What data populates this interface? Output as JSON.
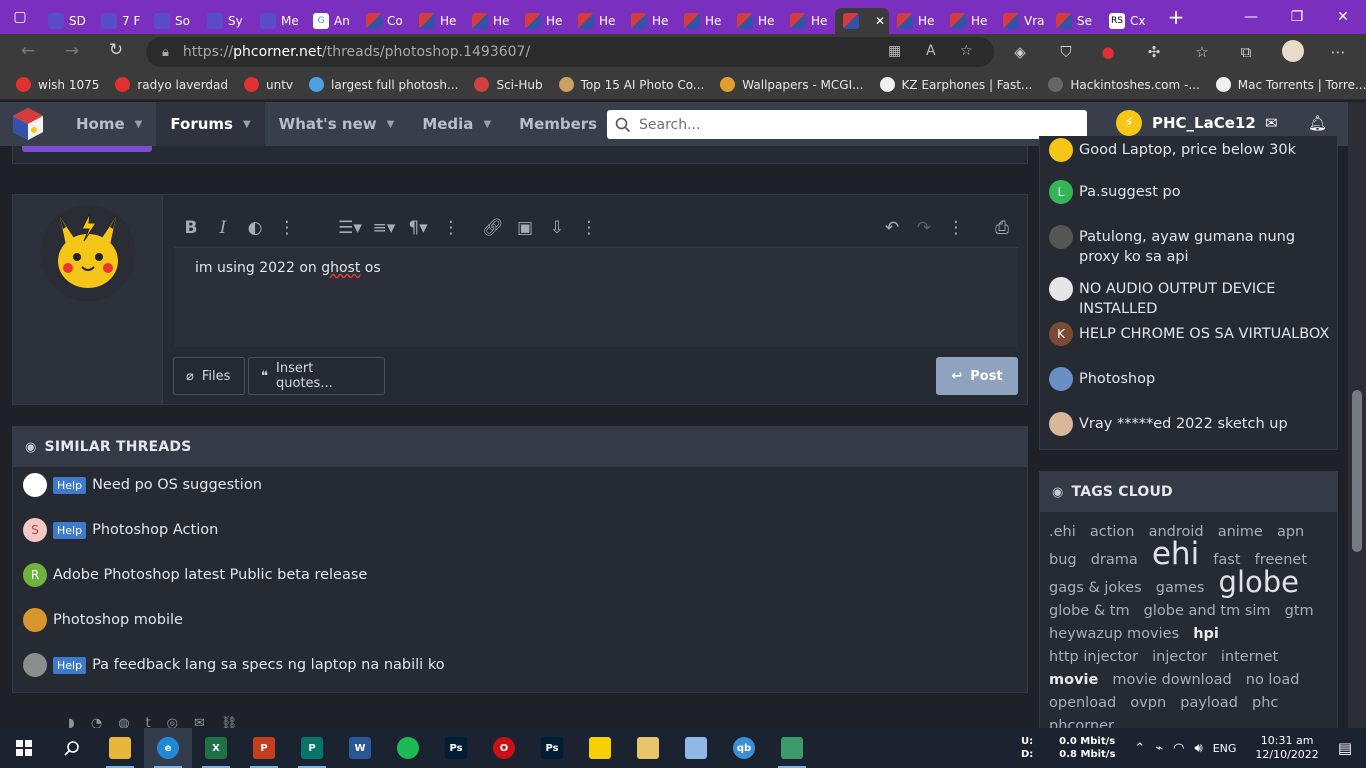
{
  "browser": {
    "tabs": [
      {
        "label": "SD",
        "icon": "globe-icon"
      },
      {
        "label": "7 F",
        "icon": "cloud-icon"
      },
      {
        "label": "So",
        "icon": "soda-icon"
      },
      {
        "label": "Sy",
        "icon": "pattern-icon"
      },
      {
        "label": "Me",
        "icon": "messenger-icon"
      },
      {
        "label": "An",
        "icon": "google-icon"
      },
      {
        "label": "Co",
        "icon": "phc-icon"
      },
      {
        "label": "He",
        "icon": "phc-icon"
      },
      {
        "label": "He",
        "icon": "phc-icon"
      },
      {
        "label": "He",
        "icon": "phc-icon"
      },
      {
        "label": "He",
        "icon": "phc-icon"
      },
      {
        "label": "He",
        "icon": "phc-icon"
      },
      {
        "label": "He",
        "icon": "phc-icon"
      },
      {
        "label": "He",
        "icon": "phc-icon"
      },
      {
        "label": "He",
        "icon": "phc-icon"
      },
      {
        "label": "",
        "icon": "phc-icon",
        "active": true
      },
      {
        "label": "He",
        "icon": "phc-icon"
      },
      {
        "label": "He",
        "icon": "phc-icon"
      },
      {
        "label": "Vra",
        "icon": "phc-icon"
      },
      {
        "label": "Se",
        "icon": "phc-icon"
      },
      {
        "label": "Cx",
        "icon": "rs-icon"
      }
    ],
    "url_scheme": "https://",
    "url_host": "phcorner.net",
    "url_path": "/threads/photoshop.1493607/",
    "bookmarks": [
      {
        "label": "wish 1075",
        "color": "#e03030"
      },
      {
        "label": "radyo laverdad",
        "color": "#e03030"
      },
      {
        "label": "untv",
        "color": "#e03030"
      },
      {
        "label": "largest full photosh...",
        "color": "#4aa3df"
      },
      {
        "label": "Sci-Hub",
        "color": "#d04040"
      },
      {
        "label": "Top 15 AI Photo Co...",
        "color": "#c9a060"
      },
      {
        "label": "Wallpapers - MCGI...",
        "color": "#e0a030"
      },
      {
        "label": "KZ Earphones | Fast...",
        "color": "#f0f0f0"
      },
      {
        "label": "Hackintoshes.com -...",
        "color": "#666666"
      },
      {
        "label": "Mac Torrents | Torre...",
        "color": "#f0f0f0"
      }
    ]
  },
  "site": {
    "nav": [
      {
        "label": "Home",
        "active": false
      },
      {
        "label": "Forums",
        "active": true
      },
      {
        "label": "What's new",
        "active": false
      },
      {
        "label": "Media",
        "active": false
      },
      {
        "label": "Members",
        "active": false
      }
    ],
    "search_placeholder": "Search...",
    "username": "PHC_LaCe12"
  },
  "editor": {
    "text_before": "im using 2022 on ",
    "text_misspelled": "ghost",
    "text_after": " os",
    "files_label": "Files",
    "insert_quotes_label": "Insert quotes...",
    "post_label": "Post"
  },
  "similar_threads": {
    "title": "SIMILAR THREADS",
    "items": [
      {
        "prefix": "Help",
        "title": "Need po OS suggestion",
        "avatar": "",
        "avatar_color": "#ffffff"
      },
      {
        "prefix": "Help",
        "title": "Photoshop Action",
        "avatar": "S",
        "avatar_color": "#f3c9c5"
      },
      {
        "prefix": "",
        "title": "Adobe Photoshop latest Public beta release",
        "avatar": "R",
        "avatar_color": "#6fb23e"
      },
      {
        "prefix": "",
        "title": "Photoshop mobile",
        "avatar": "",
        "avatar_color": "#d9962c"
      },
      {
        "prefix": "Help",
        "title": "Pa feedback lang sa specs ng laptop na nabili ko",
        "avatar": "",
        "avatar_color": "#8d8d8d"
      }
    ]
  },
  "latest_threads": {
    "items": [
      {
        "title": "Good Laptop, price below 30k",
        "avatar": "",
        "avatar_color": "#f5c518"
      },
      {
        "title": "Pa.suggest po",
        "avatar": "L",
        "avatar_color": "#35b556"
      },
      {
        "title": "Patulong, ayaw gumana nung proxy ko sa api",
        "avatar": "",
        "avatar_color": "#555555"
      },
      {
        "title": "NO AUDIO OUTPUT DEVICE INSTALLED",
        "avatar": "",
        "avatar_color": "#e6e6e6"
      },
      {
        "title": "HELP CHROME OS SA VIRTUALBOX",
        "avatar": "K",
        "avatar_color": "#7a4a35"
      },
      {
        "title": "Photoshop",
        "avatar": "",
        "avatar_color": "#6a8fc4"
      },
      {
        "title": "Vray *****ed 2022 sketch up",
        "avatar": "",
        "avatar_color": "#d8b79a"
      }
    ]
  },
  "tags_cloud": {
    "title": "TAGS CLOUD",
    "tags": [
      {
        "label": ".ehi",
        "size": "base"
      },
      {
        "label": "action",
        "size": "base"
      },
      {
        "label": "android",
        "size": "base"
      },
      {
        "label": "anime",
        "size": "base"
      },
      {
        "label": "apn",
        "size": "base"
      },
      {
        "label": "bug",
        "size": "base"
      },
      {
        "label": "drama",
        "size": "base"
      },
      {
        "label": "ehi",
        "size": "xl"
      },
      {
        "label": "fast",
        "size": "base"
      },
      {
        "label": "freenet",
        "size": "base"
      },
      {
        "label": "gags & jokes",
        "size": "base"
      },
      {
        "label": "games",
        "size": "base"
      },
      {
        "label": "globe",
        "size": "lg"
      },
      {
        "label": "globe & tm",
        "size": "base"
      },
      {
        "label": "globe and tm sim",
        "size": "base"
      },
      {
        "label": "gtm",
        "size": "base"
      },
      {
        "label": "heywazup movies",
        "size": "base"
      },
      {
        "label": "hpi",
        "size": "md"
      },
      {
        "label": "http injector",
        "size": "base"
      },
      {
        "label": "injector",
        "size": "base"
      },
      {
        "label": "internet",
        "size": "base"
      },
      {
        "label": "movie",
        "size": "md"
      },
      {
        "label": "movie download",
        "size": "base"
      },
      {
        "label": "no load",
        "size": "base"
      },
      {
        "label": "openload",
        "size": "base"
      },
      {
        "label": "ovpn",
        "size": "base"
      },
      {
        "label": "payload",
        "size": "base"
      },
      {
        "label": "phc",
        "size": "base"
      },
      {
        "label": "phcorner",
        "size": "base"
      }
    ]
  },
  "taskbar": {
    "apps": [
      {
        "name": "file-explorer",
        "label": "",
        "color": "#e8b63a",
        "open": true
      },
      {
        "name": "edge",
        "label": "e",
        "color": "#1f8ad2",
        "open": true,
        "active": true
      },
      {
        "name": "excel",
        "label": "X",
        "color": "#1e7145",
        "open": true
      },
      {
        "name": "powerpoint",
        "label": "P",
        "color": "#c43e1c",
        "open": true
      },
      {
        "name": "publisher",
        "label": "P",
        "color": "#077568",
        "open": true
      },
      {
        "name": "word",
        "label": "W",
        "color": "#2b579a",
        "open": false
      },
      {
        "name": "spotify",
        "label": "",
        "color": "#1db954",
        "open": false
      },
      {
        "name": "photoshop",
        "label": "Ps",
        "color": "#001e36",
        "open": false
      },
      {
        "name": "opera",
        "label": "O",
        "color": "#cc0f16",
        "open": false
      },
      {
        "name": "photoshop-2",
        "label": "Ps",
        "color": "#001e36",
        "open": false
      },
      {
        "name": "player",
        "label": "",
        "color": "#f4d000",
        "open": false
      },
      {
        "name": "folder",
        "label": "",
        "color": "#e8c46a",
        "open": false
      },
      {
        "name": "notes",
        "label": "",
        "color": "#8fb8e8",
        "open": false
      },
      {
        "name": "qbittorrent",
        "label": "qb",
        "color": "#3a8fd6",
        "open": false
      },
      {
        "name": "3d-app",
        "label": "",
        "color": "#3c9a6a",
        "open": true
      }
    ],
    "net_up_label": "U:",
    "net_down_label": "D:",
    "net_up": "0.0 Mbit/s",
    "net_down": "0.8 Mbit/s",
    "language": "ENG",
    "time": "10:31 am",
    "date": "12/10/2022"
  }
}
